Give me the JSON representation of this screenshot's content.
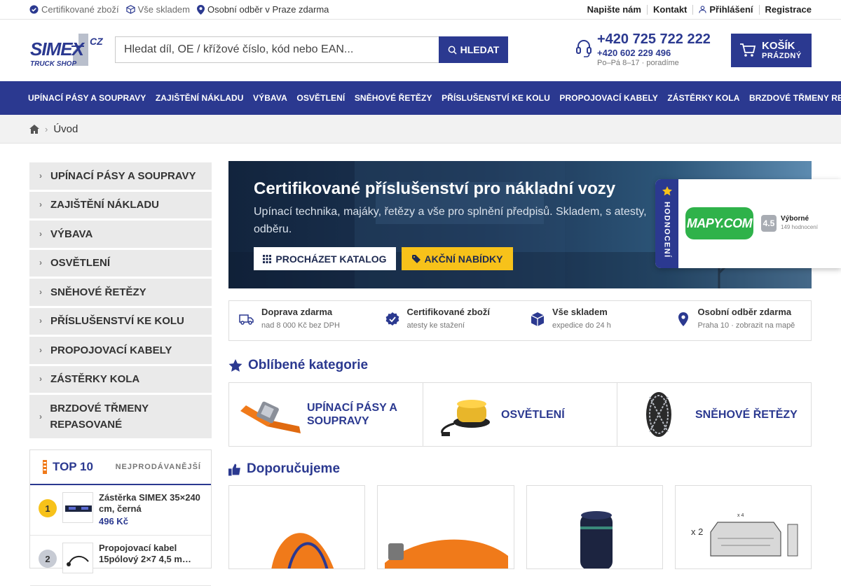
{
  "topbar": {
    "certified": "Certifikované zboží",
    "stock": "Vše skladem",
    "pickup": "Osobní odběr v Praze zdarma",
    "write_us": "Napište nám",
    "contact": "Kontakt",
    "login": "Přihlášení",
    "register": "Registrace"
  },
  "header": {
    "logo_text": "SIMEX",
    "logo_sub": "TRUCK SHOP",
    "logo_cz": "CZ",
    "search_placeholder": "Hledat díl, OE / křížové číslo, kód nebo EAN...",
    "search_button": "HLEDAT",
    "phone_main": "+420 725 722 222",
    "phone_secondary": "+420 602 229 496",
    "hours": "Po–Pá 8–17 · poradíme",
    "cart_title": "KOŠÍK",
    "cart_status": "PRÁZDNÝ"
  },
  "nav": [
    "UPÍNACÍ PÁSY A SOUPRAVY",
    "ZAJIŠTĚNÍ NÁKLADU",
    "VÝBAVA",
    "OSVĚTLENÍ",
    "SNĚHOVÉ ŘETĚZY",
    "PŘÍSLUŠENSTVÍ KE KOLU",
    "PROPOJOVACÍ KABELY",
    "ZÁSTĚRKY KOLA",
    "BRZDOVÉ TŘMENY REPASOVANÉ"
  ],
  "breadcrumb": {
    "home": "Úvod"
  },
  "sidebar": [
    "UPÍNACÍ PÁSY A SOUPRAVY",
    "ZAJIŠTĚNÍ NÁKLADU",
    "VÝBAVA",
    "OSVĚTLENÍ",
    "SNĚHOVÉ ŘETĚZY",
    "PŘÍSLUŠENSTVÍ KE KOLU",
    "PROPOJOVACÍ KABELY",
    "ZÁSTĚRKY KOLA",
    "BRZDOVÉ TŘMENY REPASOVANÉ"
  ],
  "top10": {
    "title": "TOP 10",
    "subtitle": "NEJPRODÁVANĚJŠÍ",
    "items": [
      {
        "rank": "1",
        "name": "Zástěrka SIMEX 35×240 cm, černá",
        "price": "496 Kč"
      },
      {
        "rank": "2",
        "name": "Propojovací kabel 15pólový 2×7 4,5 m…",
        "price": ""
      }
    ]
  },
  "hero": {
    "title": "Certifikované příslušenství pro nákladní vozy",
    "subtitle": "Upínací technika, majáky, řetězy a vše pro splnění předpisů. Skladem, s atesty, odběru.",
    "btn_catalog": "PROCHÁZET KATALOG",
    "btn_offers": "AKČNÍ NABÍDKY"
  },
  "rating": {
    "tab_label": "HODNOCENÍ",
    "brand": "MAPY.COM",
    "score": "4.5",
    "label": "Výborné",
    "count": "149 hodnocení"
  },
  "features": [
    {
      "title": "Doprava zdarma",
      "sub": "nad 8 000 Kč bez DPH",
      "icon": "truck-icon"
    },
    {
      "title": "Certifikované zboží",
      "sub": "atesty ke stažení",
      "icon": "badge-check-icon"
    },
    {
      "title": "Vše skladem",
      "sub": "expedice do 24 h",
      "icon": "box-icon"
    },
    {
      "title": "Osobní odběr zdarma",
      "sub": "Praha 10 · zobrazit na mapě",
      "icon": "map-pin-icon"
    }
  ],
  "favorites": {
    "title": "Oblíbené kategorie",
    "items": [
      "UPÍNACÍ PÁSY A SOUPRAVY",
      "OSVĚTLENÍ",
      "SNĚHOVÉ ŘETĚZY"
    ]
  },
  "recommended": {
    "title": "Doporučujeme",
    "badge": "x 2",
    "dimension": "x 4"
  },
  "colors": {
    "primary": "#2b3990",
    "accent": "#f7c21a",
    "orange": "#f07a1a"
  }
}
